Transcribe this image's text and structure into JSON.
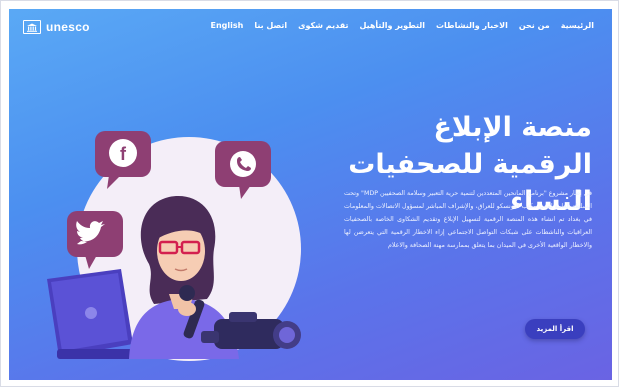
{
  "logo": {
    "text": "unesco"
  },
  "nav": {
    "items": [
      {
        "label": "الرئيسية"
      },
      {
        "label": "من نحن"
      },
      {
        "label": "الاخبار والنشاطات"
      },
      {
        "label": "التطوير والتأهيل"
      },
      {
        "label": "تقديم شكوى"
      },
      {
        "label": "اتصل بنا"
      },
      {
        "label": "English"
      }
    ]
  },
  "hero": {
    "title": "منصة الإبلاغ الرقمية للصحفيات النساء",
    "description": "في إطار مشروع \"برنامج المانحين المتعددين لتنمية حرية التعبير وسلامة الصحفيين MDP\" وتحت السلطة العامة لمدير مكتب اليونسكو للعراق، والإشراف المباشر لمسؤول الاتصالات والمعلومات في بغداد تم انشاء هذه المنصة الرقمية لتسهيل الإبلاغ وتقديم الشكاوى الخاصة بالصحفيات العراقيات والناشطات على شبكات التواصل الاجتماعي إزاء الاخطار الرقمية التي يتعرضن لها والاخطار الواقعية الأخرى في الميدان بما يتعلق بممارسة مهنة الصحافة والاعلام",
    "cta_label": "اقرأ المزيد"
  },
  "colors": {
    "gradient_start": "#5aa9f5",
    "gradient_end": "#6a63e3",
    "cta_bg": "#3a3fbf",
    "bubble": "#8e3f73",
    "circle": "#f4eef8"
  },
  "icons": [
    "facebook-icon",
    "whatsapp-icon",
    "twitter-icon",
    "unesco-temple-icon"
  ]
}
